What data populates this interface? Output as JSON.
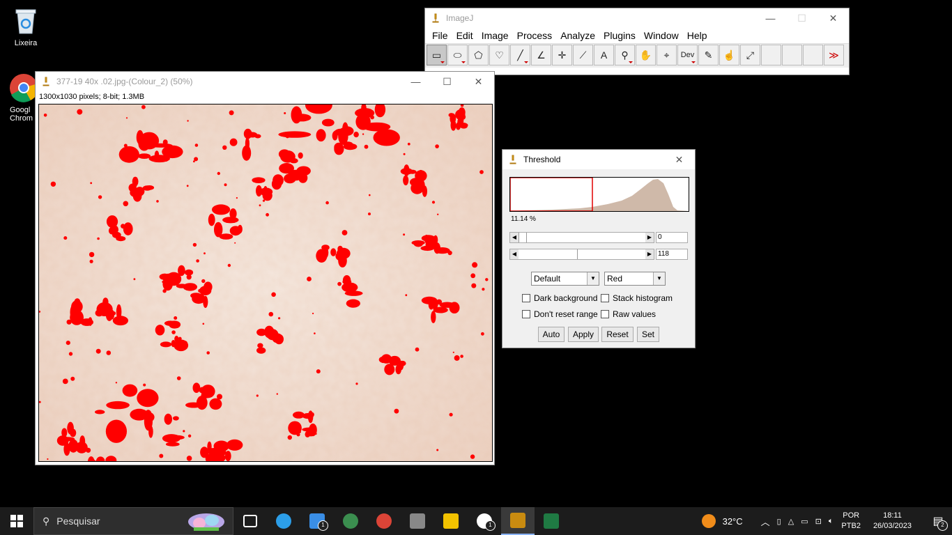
{
  "desktop": {
    "icons": [
      {
        "label": "Lixeira",
        "icon": "recycle-bin-icon"
      },
      {
        "label": "Googl\nChrom",
        "icon": "chrome-icon"
      }
    ]
  },
  "imagej": {
    "title": "ImageJ",
    "menu": [
      "File",
      "Edit",
      "Image",
      "Process",
      "Analyze",
      "Plugins",
      "Window",
      "Help"
    ],
    "tools": [
      {
        "name": "rectangle-tool",
        "glyph": "▭"
      },
      {
        "name": "oval-tool",
        "glyph": "⬭"
      },
      {
        "name": "polygon-tool",
        "glyph": "⬠"
      },
      {
        "name": "freehand-tool",
        "glyph": "♡"
      },
      {
        "name": "line-tool",
        "glyph": "╱"
      },
      {
        "name": "angle-tool",
        "glyph": "∠"
      },
      {
        "name": "point-tool",
        "glyph": "✛"
      },
      {
        "name": "wand-tool",
        "glyph": "⟋"
      },
      {
        "name": "text-tool",
        "glyph": "A"
      },
      {
        "name": "magnifying-glass-tool",
        "glyph": "⚲"
      },
      {
        "name": "scrolling-tool",
        "glyph": "✋"
      },
      {
        "name": "color-picker-tool",
        "glyph": "⌖"
      },
      {
        "name": "dev-tool",
        "glyph": "Dev"
      },
      {
        "name": "brush-tool",
        "glyph": "✎"
      },
      {
        "name": "flood-fill-tool",
        "glyph": "☝"
      },
      {
        "name": "pipette-tool",
        "glyph": "⤢"
      },
      {
        "name": "empty-slot-1",
        "glyph": ""
      },
      {
        "name": "empty-slot-2",
        "glyph": ""
      },
      {
        "name": "empty-slot-3",
        "glyph": ""
      },
      {
        "name": "more-tools",
        "glyph": "≫"
      }
    ]
  },
  "image_window": {
    "title": "377-19 40x .02.jpg-(Colour_2) (50%)",
    "info": "1300x1030 pixels; 8-bit; 1.3MB"
  },
  "threshold": {
    "title": "Threshold",
    "percent": "11.14 %",
    "min_value": "0",
    "max_value": "118",
    "method": "Default",
    "display": "Red",
    "checkboxes": {
      "dark_background": "Dark background",
      "stack_histogram": "Stack histogram",
      "dont_reset_range": "Don't reset range",
      "raw_values": "Raw values"
    },
    "buttons": {
      "auto": "Auto",
      "apply": "Apply",
      "reset": "Reset",
      "set": "Set"
    }
  },
  "taskbar": {
    "search_placeholder": "Pesquisar",
    "apps": [
      {
        "name": "task-view-icon",
        "badge": ""
      },
      {
        "name": "edge-icon",
        "badge": ""
      },
      {
        "name": "mail-icon",
        "badge": "1"
      },
      {
        "name": "browser-globe-icon",
        "badge": ""
      },
      {
        "name": "chrome-icon",
        "badge": ""
      },
      {
        "name": "calculator-icon",
        "badge": ""
      },
      {
        "name": "file-explorer-icon",
        "badge": ""
      },
      {
        "name": "whatsapp-icon",
        "badge": "1"
      },
      {
        "name": "imagej-icon",
        "badge": ""
      },
      {
        "name": "excel-icon",
        "badge": ""
      }
    ],
    "weather": "32°C",
    "language": "POR",
    "keyboard": "PTB2",
    "time": "18:11",
    "date": "26/03/2023",
    "notifications": "2"
  },
  "colors": {
    "threshold_red": "#ff0000",
    "stain_background": "#f3e1d6",
    "taskbar": "#1c1c1c"
  }
}
